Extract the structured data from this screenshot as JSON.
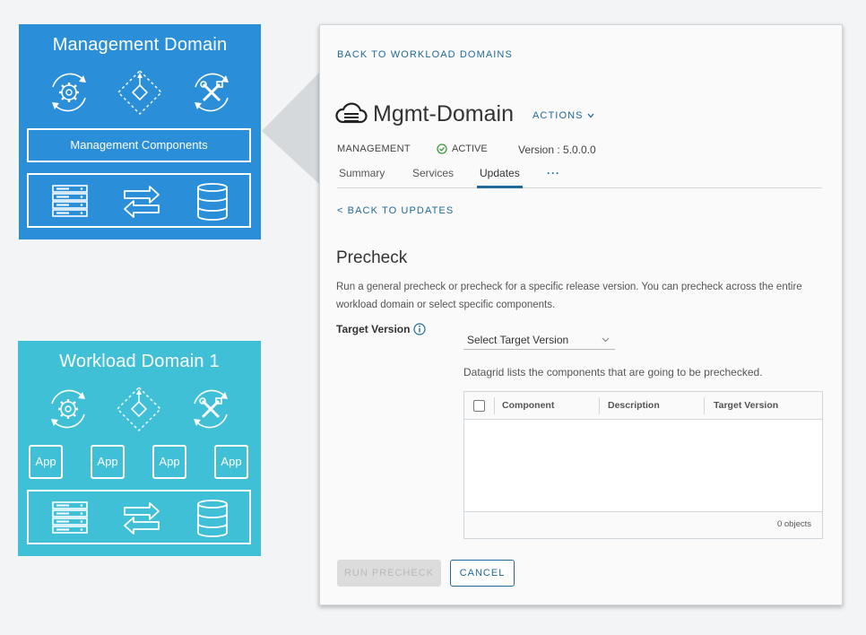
{
  "tiles": {
    "management": {
      "title": "Management Domain",
      "components_label": "Management Components",
      "color": "#2a8fd8"
    },
    "workload": {
      "title": "Workload Domain 1",
      "app_label": "App",
      "color": "#40c0d6"
    }
  },
  "panel": {
    "back_link": "BACK TO WORKLOAD DOMAINS",
    "domain_name": "Mgmt-Domain",
    "actions_label": "ACTIONS",
    "meta": {
      "type": "MANAGEMENT",
      "status": "ACTIVE",
      "version": "Version : 5.0.0.0"
    },
    "tabs": [
      {
        "label": "Summary"
      },
      {
        "label": "Services"
      },
      {
        "label": "Updates"
      },
      {
        "label": "···"
      }
    ],
    "active_tab": "Updates",
    "back_updates": "< BACK TO UPDATES",
    "precheck": {
      "title": "Precheck",
      "description": "Run a general precheck or precheck for a specific release version. You can precheck across the entire workload domain or select specific components.",
      "target_version_label": "Target Version",
      "select_placeholder": "Select Target Version",
      "datagrid_caption": "Datagrid lists the components that are going to be prechecked.",
      "columns": [
        "Component",
        "Description",
        "Target Version"
      ],
      "footer": "0 objects",
      "run_button": "RUN PRECHECK",
      "cancel_button": "CANCEL"
    }
  },
  "colors": {
    "accent": "#1f6a9a",
    "status_ok": "#3c9a3c"
  }
}
